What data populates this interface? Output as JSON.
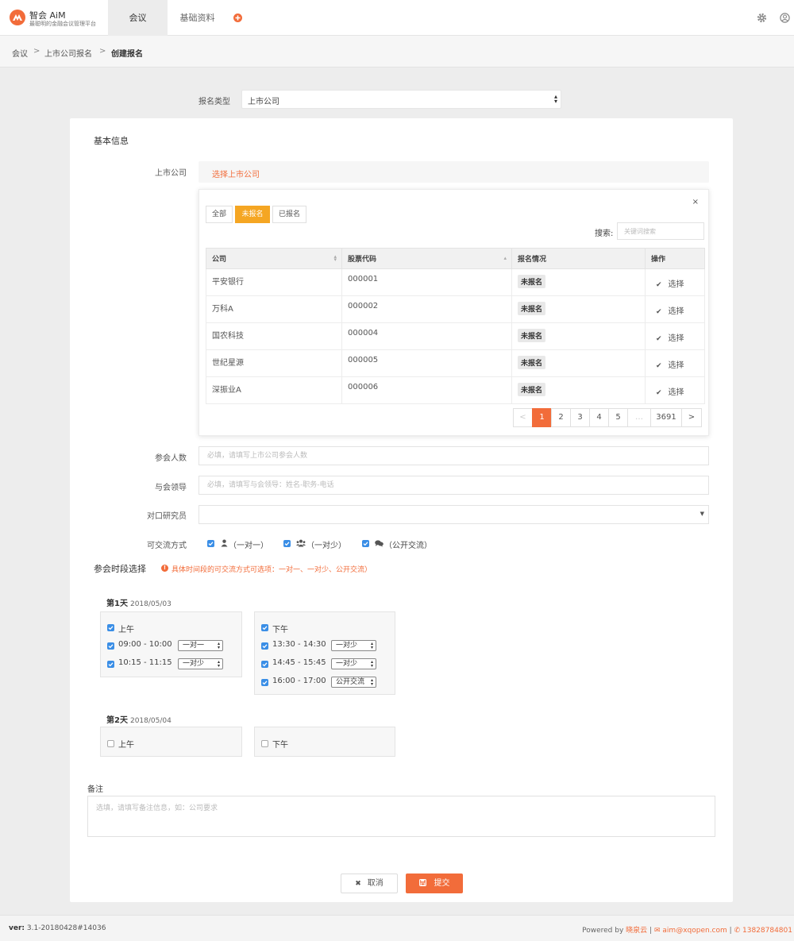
{
  "app": {
    "logo_text": "AiM",
    "title": "智会 AiM",
    "subtitle": "最聪明的金融会议管理平台"
  },
  "nav": {
    "tabs": [
      {
        "label": "会议",
        "active": true
      },
      {
        "label": "基础资料",
        "active": false
      }
    ]
  },
  "breadcrumb": [
    "会议",
    "上市公司报名",
    "创建报名"
  ],
  "signup_type": {
    "label": "报名类型",
    "value": "上市公司"
  },
  "basic_info": {
    "title": "基本信息",
    "company_label": "上市公司",
    "company_placeholder": "选择上市公司"
  },
  "picker": {
    "filters": [
      {
        "label": "全部",
        "active": false
      },
      {
        "label": "未报名",
        "active": true
      },
      {
        "label": "已报名",
        "active": false
      }
    ],
    "search_label": "搜索:",
    "search_placeholder": "关键词搜索",
    "close_label": "×",
    "columns": [
      "公司",
      "股票代码",
      "报名情况",
      "操作"
    ],
    "rows": [
      {
        "company": "平安银行",
        "code": "000001",
        "status": "未报名",
        "action": "选择"
      },
      {
        "company": "万科A",
        "code": "000002",
        "status": "未报名",
        "action": "选择"
      },
      {
        "company": "国农科技",
        "code": "000004",
        "status": "未报名",
        "action": "选择"
      },
      {
        "company": "世纪星源",
        "code": "000005",
        "status": "未报名",
        "action": "选择"
      },
      {
        "company": "深振业A",
        "code": "000006",
        "status": "未报名",
        "action": "选择"
      }
    ],
    "pagination": {
      "prev": "<",
      "pages": [
        "1",
        "2",
        "3",
        "4",
        "5"
      ],
      "ellipsis": "…",
      "last": "3691",
      "next": ">",
      "current": "1"
    }
  },
  "fields": {
    "attendees": {
      "label": "参会人数",
      "placeholder": "必填，请填写上市公司参会人数"
    },
    "leaders": {
      "label": "与会领导",
      "placeholder": "必填，请填写与会领导：姓名-职务-电话"
    },
    "researcher": {
      "label": "对口研究员",
      "value": ""
    },
    "exchange": {
      "label": "可交流方式",
      "options": [
        {
          "label": "（一对一）",
          "icon": "user-icon",
          "checked": true
        },
        {
          "label": "（一对少）",
          "icon": "users-icon",
          "checked": true
        },
        {
          "label": "（公开交流）",
          "icon": "comments-icon",
          "checked": true
        }
      ]
    }
  },
  "schedule": {
    "title": "参会时段选择",
    "hint": "具体时间段的可交流方式可选项：一对一、一对少、公开交流）",
    "days": [
      {
        "title": "第1天",
        "date": "2018/05/03",
        "am": {
          "label": "上午",
          "checked": true,
          "slots": [
            {
              "time": "09:00 - 10:00",
              "mode": "一对一",
              "checked": true
            },
            {
              "time": "10:15 - 11:15",
              "mode": "一对少",
              "checked": true
            }
          ]
        },
        "pm": {
          "label": "下午",
          "checked": true,
          "slots": [
            {
              "time": "13:30 - 14:30",
              "mode": "一对少",
              "checked": true
            },
            {
              "time": "14:45 - 15:45",
              "mode": "一对少",
              "checked": true
            },
            {
              "time": "16:00 - 17:00",
              "mode": "公开交流",
              "checked": true
            }
          ]
        }
      },
      {
        "title": "第2天",
        "date": "2018/05/04",
        "am": {
          "label": "上午",
          "checked": false,
          "slots": []
        },
        "pm": {
          "label": "下午",
          "checked": false,
          "slots": []
        }
      }
    ]
  },
  "notes": {
    "label": "备注",
    "placeholder": "选填，请填写备注信息，如：公司要求"
  },
  "actions": {
    "cancel": "取消",
    "submit": "提交"
  },
  "footer": {
    "version_label": "ver:",
    "version": "3.1-20180428#14036",
    "powered_by": "Powered by",
    "brand": "晓泉云",
    "sep": "|",
    "email": "aim@xqopen.com",
    "phone": "13828784801"
  },
  "colors": {
    "accent": "#f26c3a",
    "tab_active": "#f5a623",
    "checkbox": "#3a8ee6"
  }
}
